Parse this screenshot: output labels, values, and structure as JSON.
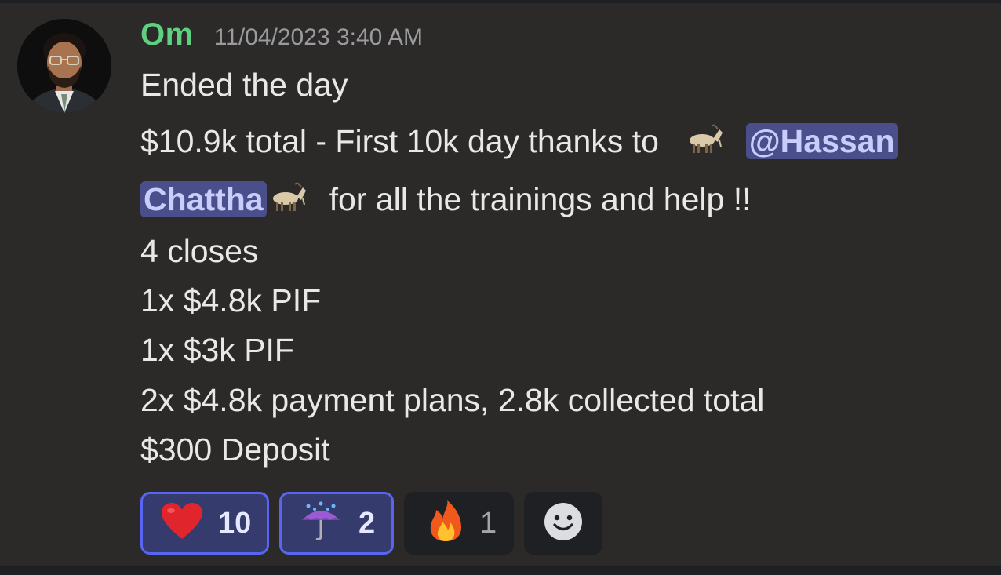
{
  "message": {
    "author": "Om",
    "timestamp": "11/04/2023 3:40 AM",
    "line1": "Ended the day",
    "line2_text": "$10.9k total - First 10k day thanks to",
    "mention_part1": "@Hassan",
    "mention_part2": "Chattha",
    "line3_text": "for all the trainings and help !!",
    "line4": "4 closes",
    "line5": "1x $4.8k PIF",
    "line6": "1x $3k PIF",
    "line7": "2x $4.8k payment plans, 2.8k collected total",
    "line8": "$300 Deposit"
  },
  "reactions": [
    {
      "icon": "heart-icon",
      "count": "10",
      "active": true
    },
    {
      "icon": "umbrella-rain-icon",
      "count": "2",
      "active": true
    },
    {
      "icon": "fire-icon",
      "count": "1",
      "active": false
    }
  ],
  "add_reaction_icon": "smiley-add-reaction-icon",
  "colors": {
    "background": "#2c2a28",
    "username": "#5fcf80",
    "mention_bg": "#4a4e8a",
    "active_reaction_border": "#5865f2"
  }
}
